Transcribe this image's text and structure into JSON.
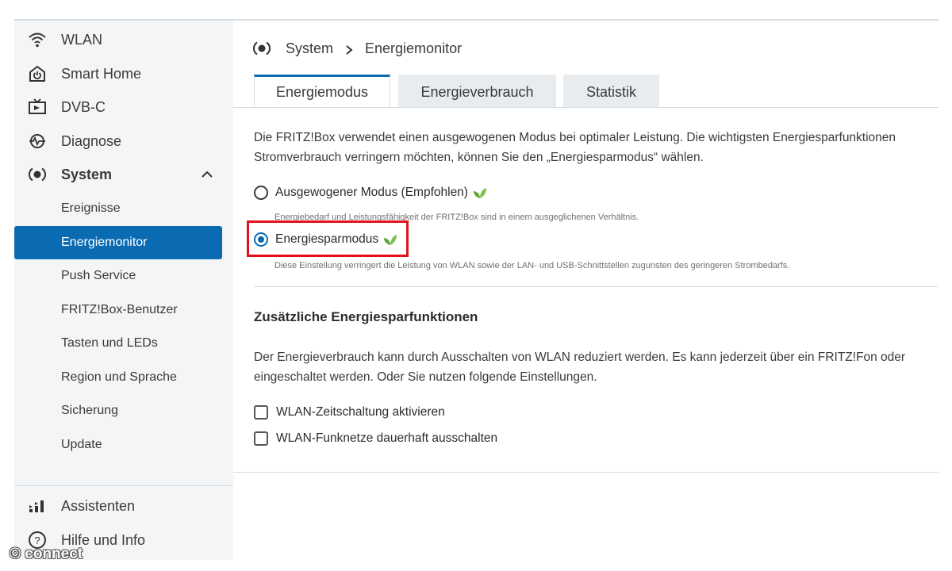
{
  "sidebar": {
    "items": [
      {
        "label": "WLAN",
        "icon": "wifi-icon"
      },
      {
        "label": "Smart Home",
        "icon": "smart-home-icon"
      },
      {
        "label": "DVB-C",
        "icon": "tv-icon"
      },
      {
        "label": "Diagnose",
        "icon": "diagnose-icon"
      },
      {
        "label": "System",
        "icon": "system-icon",
        "expanded": true
      }
    ],
    "sub_items": [
      {
        "label": "Ereignisse"
      },
      {
        "label": "Energiemonitor",
        "active": true
      },
      {
        "label": "Push Service"
      },
      {
        "label": "FRITZ!Box-Benutzer"
      },
      {
        "label": "Tasten und LEDs"
      },
      {
        "label": "Region und Sprache"
      },
      {
        "label": "Sicherung"
      },
      {
        "label": "Update"
      }
    ],
    "footer_items": [
      {
        "label": "Assistenten",
        "icon": "wizard-icon"
      },
      {
        "label": "Hilfe und Info",
        "icon": "help-icon"
      }
    ]
  },
  "breadcrumb": {
    "root": "System",
    "current": "Energiemonitor"
  },
  "tabs": [
    {
      "label": "Energiemodus",
      "active": true
    },
    {
      "label": "Energieverbrauch"
    },
    {
      "label": "Statistik"
    }
  ],
  "intro": {
    "line1": "Die FRITZ!Box verwendet einen ausgewogenen Modus bei optimaler Leistung. Die wichtigsten Energiesparfunktionen",
    "line2": "Stromverbrauch verringern möchten, können Sie den „Energiesparmodus“ wählen."
  },
  "modes": [
    {
      "label": "Ausgewogener Modus (Empfohlen)",
      "hint": "Energiebedarf und Leistungsfähigkeit der FRITZ!Box sind in einem ausgeglichenen Verhältnis.",
      "selected": false
    },
    {
      "label": "Energiesparmodus",
      "hint": "Diese Einstellung verringert die Leistung von WLAN sowie der LAN- und USB-Schnittstellen zugunsten des geringeren Strombedarfs.",
      "selected": true
    }
  ],
  "additional": {
    "heading": "Zusätzliche Energiesparfunktionen",
    "line1": "Der Energieverbrauch kann durch Ausschalten von WLAN reduziert werden. Es kann jederzeit über ein FRITZ!Fon oder",
    "line2": "eingeschaltet werden. Oder Sie nutzen folgende Einstellungen.",
    "checkboxes": [
      {
        "label": "WLAN-Zeitschaltung aktivieren",
        "checked": false
      },
      {
        "label": "WLAN-Funknetze dauerhaft ausschalten",
        "checked": false
      }
    ]
  },
  "watermark": "© connect",
  "colors": {
    "accent": "#0a6bb3",
    "highlight": "#e2121b",
    "leaf": "#5aa832"
  }
}
